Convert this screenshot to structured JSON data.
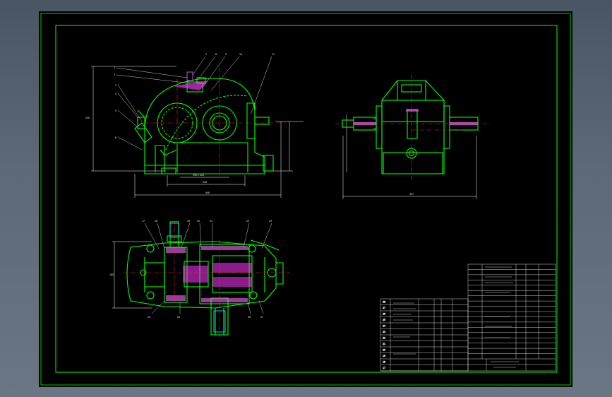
{
  "colors": {
    "outer_bg": "#56616f",
    "sheet": "#000000",
    "frame": "#00ff00",
    "body_line": "#00ff00",
    "center_line": "#ff2020",
    "dim_line": "#ffffff",
    "hatch": "#ff33ff",
    "shaft": "#ff66ff",
    "accent": "#00e5ff"
  },
  "views": {
    "front": {
      "label": "",
      "dims": {
        "width": "440",
        "inner": "310",
        "height": "230",
        "sub": "290 x 220"
      }
    },
    "side": {
      "label": "",
      "dims": {
        "width": "327",
        "height": "120"
      }
    },
    "top": {
      "label": "",
      "dims": {
        "height": "185"
      }
    }
  },
  "callouts": {
    "front": [
      "1",
      "2",
      "3",
      "4",
      "5",
      "6",
      "7",
      "8",
      "9",
      "10",
      "11"
    ],
    "top": [
      "17",
      "18",
      "19",
      "20",
      "21",
      "22",
      "23",
      "24",
      "25",
      "26",
      "27"
    ]
  },
  "title_block": {
    "title": ""
  },
  "parts_rows": [
    [
      "28",
      "",
      "",
      ""
    ],
    [
      "27",
      "",
      "",
      ""
    ],
    [
      "26",
      "",
      "",
      ""
    ],
    [
      "25",
      "",
      "",
      ""
    ],
    [
      "24",
      "",
      "",
      ""
    ],
    [
      "23",
      "",
      "",
      ""
    ],
    [
      "22",
      "",
      "",
      ""
    ],
    [
      "21",
      "",
      "",
      ""
    ],
    [
      "20",
      "",
      "",
      ""
    ],
    [
      "19",
      "",
      "",
      ""
    ],
    [
      "18",
      "",
      "",
      ""
    ],
    [
      "17",
      "",
      "",
      ""
    ]
  ]
}
